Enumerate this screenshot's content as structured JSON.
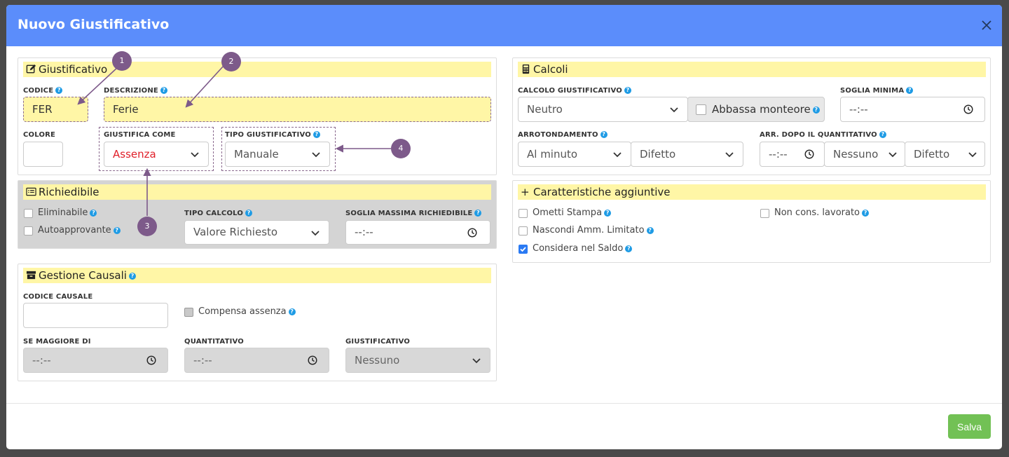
{
  "modal": {
    "title": "Nuovo Giustificativo",
    "save_label": "Salva"
  },
  "giustificativo": {
    "title": "Giustificativo",
    "codice_label": "CODICE",
    "codice_value": "FER",
    "descrizione_label": "DESCRIZIONE",
    "descrizione_value": "Ferie",
    "colore_label": "COLORE",
    "giustifica_label": "GIUSTIFICA COME",
    "giustifica_value": "Assenza",
    "tipo_label": "TIPO GIUSTIFICATIVO",
    "tipo_value": "Manuale"
  },
  "richiedibile": {
    "title": "Richiedibile",
    "eliminabile": "Eliminabile",
    "autoapprovante": "Autoapprovante",
    "tipo_calcolo_label": "TIPO CALCOLO",
    "tipo_calcolo_value": "Valore Richiesto",
    "soglia_label": "SOGLIA MASSIMA RICHIEDIBILE",
    "soglia_value": "--:--"
  },
  "causali": {
    "title": "Gestione Causali",
    "codice_label": "CODICE CAUSALE",
    "compensa": "Compensa assenza",
    "maggiore_label": "SE MAGGIORE DI",
    "maggiore_value": "--:--",
    "quantitativo_label": "QUANTITATIVO",
    "quantitativo_value": "--:--",
    "giust_label": "GIUSTIFICATIVO",
    "giust_value": "Nessuno"
  },
  "calcoli": {
    "title": "Calcoli",
    "calcolo_label": "CALCOLO GIUSTIFICATIVO",
    "calcolo_value": "Neutro",
    "abbassa": "Abbassa monteore",
    "soglia_min_label": "SOGLIA MINIMA",
    "soglia_min_value": "--:--",
    "arrot_label": "ARROTONDAMENTO",
    "arrot_value": "Al minuto",
    "arrot_mode": "Difetto",
    "arr_dopo_label": "ARR. DOPO IL QUANTITATIVO",
    "arr_dopo_time": "--:--",
    "arr_dopo_value": "Nessuno",
    "arr_dopo_mode": "Difetto"
  },
  "caratteristiche": {
    "title": "Caratteristiche aggiuntive",
    "plus": "+",
    "ometti": "Ometti Stampa",
    "nascondi": "Nascondi Amm. Limitato",
    "considera": "Considera nel Saldo",
    "noncons": "Non cons. lavorato"
  },
  "markers": [
    "1",
    "2",
    "3",
    "4"
  ],
  "help_glyph": "?",
  "colors": {
    "header": "#5b8dfb",
    "highlight": "#fff6a6",
    "marker": "#7d5a8a",
    "save": "#72c155",
    "error_text": "#e0202a"
  }
}
